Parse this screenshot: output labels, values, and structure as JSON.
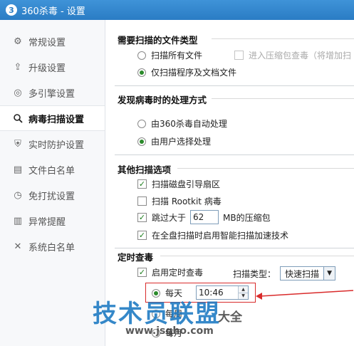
{
  "window": {
    "logo_text": "3",
    "title": "360杀毒 - 设置"
  },
  "sidebar": {
    "items": [
      {
        "label": "常规设置",
        "icon": "gear-icon"
      },
      {
        "label": "升级设置",
        "icon": "upload-icon"
      },
      {
        "label": "多引擎设置",
        "icon": "engine-icon"
      },
      {
        "label": "病毒扫描设置",
        "icon": "search-icon"
      },
      {
        "label": "实时防护设置",
        "icon": "shield-icon"
      },
      {
        "label": "文件白名单",
        "icon": "document-icon"
      },
      {
        "label": "免打扰设置",
        "icon": "quiet-icon"
      },
      {
        "label": "异常提醒",
        "icon": "chart-icon"
      },
      {
        "label": "系统白名单",
        "icon": "tools-icon"
      }
    ],
    "active_index": 3
  },
  "file_types": {
    "title": "需要扫描的文件类型",
    "option_all": "扫描所有文件",
    "option_archive": "进入压缩包查毒（将增加扫",
    "option_programs": "仅扫描程序及文档文件"
  },
  "virus_action": {
    "title": "发现病毒时的处理方式",
    "option_auto": "由360杀毒自动处理",
    "option_user": "由用户选择处理"
  },
  "other_options": {
    "title": "其他扫描选项",
    "boot_sector": "扫描磁盘引导扇区",
    "rootkit": "扫描 Rootkit 病毒",
    "skip_prefix": "跳过大于",
    "skip_value": "62",
    "skip_suffix": "MB的压缩包",
    "smart_accel": "在全盘扫描时启用智能扫描加速技术"
  },
  "scheduled": {
    "title": "定时查毒",
    "enable_label": "启用定时查毒",
    "scan_type_label": "扫描类型：",
    "scan_type_value": "快速扫描",
    "daily": "每天",
    "time_value": "10:46",
    "weekly": "每周",
    "monthly": "每月"
  },
  "watermark": {
    "main": "技术员联盟",
    "url": "www.jsgho.com",
    "side": "大全"
  },
  "colors": {
    "titlebar": "#2a7cc4",
    "check": "#1c7d1c",
    "highlight": "#d92b2b",
    "watermark": "#1a78c2"
  }
}
